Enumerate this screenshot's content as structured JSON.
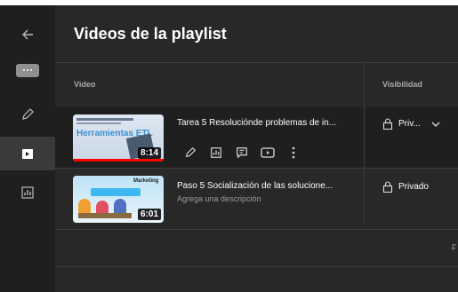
{
  "header": {
    "title": "Videos de la playlist"
  },
  "sidebar": {
    "items": [
      {
        "name": "back",
        "icon": "arrow-left-icon"
      },
      {
        "name": "more",
        "icon": "more-horizontal-icon"
      },
      {
        "name": "edit",
        "icon": "pencil-icon"
      },
      {
        "name": "videos",
        "icon": "video-playlist-icon",
        "active": true
      },
      {
        "name": "analytics",
        "icon": "analytics-icon"
      }
    ]
  },
  "table": {
    "headers": {
      "video": "Video",
      "visibility": "Visibilidad"
    }
  },
  "rows": [
    {
      "title": "Tarea 5 Resoluciónde problemas de in...",
      "description": "",
      "duration": "8:14",
      "visibility": "Priv...",
      "thumbnail": {
        "title": "Herramientas ETL",
        "lines": "ETAPA 4. RESOLUCIÓN DE PROBLEMAS"
      },
      "actions": [
        "pencil-icon",
        "analytics-icon",
        "comments-icon",
        "youtube-icon",
        "more-vertical-icon"
      ]
    },
    {
      "title": "Paso 5 Socialización de las solucione...",
      "description": "Agrega una descripción",
      "duration": "6:01",
      "visibility": "Privado",
      "thumbnail": {
        "title": "Marketing"
      }
    }
  ],
  "pagination": {
    "text": "F"
  },
  "colors": {
    "background": "#282828",
    "sidebar": "#1f1f1f",
    "text_secondary": "#aaaaaa",
    "divider": "#3e3e3e"
  }
}
